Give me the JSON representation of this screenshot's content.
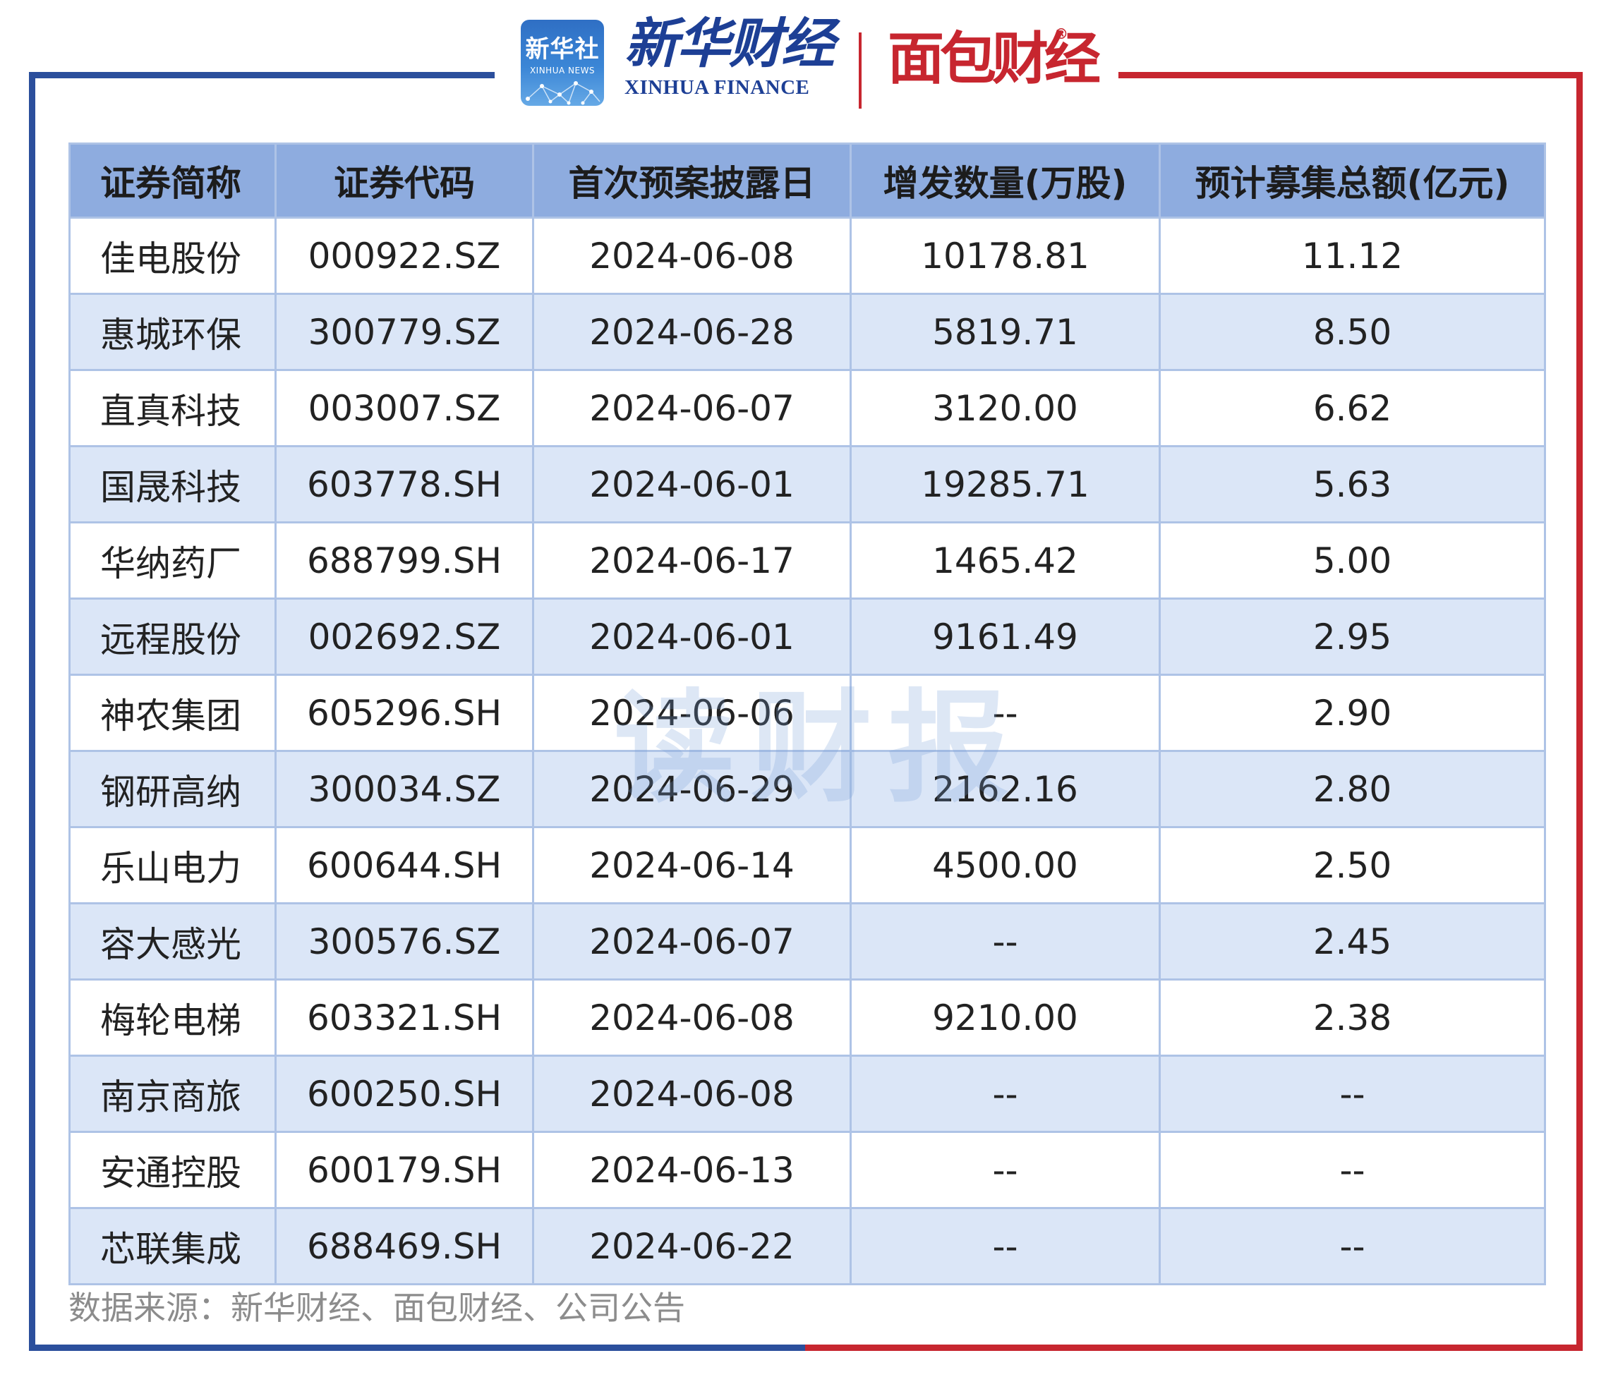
{
  "header": {
    "xinhuashe_logo_cn": "新华社",
    "xinhuashe_logo_en": "XINHUA NEWS",
    "xinhua_finance_cn": "新华财经",
    "xinhua_finance_en": "XINHUA FINANCE",
    "mianbao_logo": "面包财经",
    "registered_mark": "®",
    "brand_colors": {
      "blue": "#2b4f9c",
      "red": "#c7262f"
    }
  },
  "table": {
    "columns": [
      "证券简称",
      "证券代码",
      "首次预案披露日",
      "增发数量(万股)",
      "预计募集总额(亿元)"
    ],
    "rows": [
      [
        "佳电股份",
        "000922.SZ",
        "2024-06-08",
        "10178.81",
        "11.12"
      ],
      [
        "惠城环保",
        "300779.SZ",
        "2024-06-28",
        "5819.71",
        "8.50"
      ],
      [
        "直真科技",
        "003007.SZ",
        "2024-06-07",
        "3120.00",
        "6.62"
      ],
      [
        "国晟科技",
        "603778.SH",
        "2024-06-01",
        "19285.71",
        "5.63"
      ],
      [
        "华纳药厂",
        "688799.SH",
        "2024-06-17",
        "1465.42",
        "5.00"
      ],
      [
        "远程股份",
        "002692.SZ",
        "2024-06-01",
        "9161.49",
        "2.95"
      ],
      [
        "神农集团",
        "605296.SH",
        "2024-06-06",
        "--",
        "2.90"
      ],
      [
        "钢研高纳",
        "300034.SZ",
        "2024-06-29",
        "2162.16",
        "2.80"
      ],
      [
        "乐山电力",
        "600644.SH",
        "2024-06-14",
        "4500.00",
        "2.50"
      ],
      [
        "容大感光",
        "300576.SZ",
        "2024-06-07",
        "--",
        "2.45"
      ],
      [
        "梅轮电梯",
        "603321.SH",
        "2024-06-08",
        "9210.00",
        "2.38"
      ],
      [
        "南京商旅",
        "600250.SH",
        "2024-06-08",
        "--",
        "--"
      ],
      [
        "安通控股",
        "600179.SH",
        "2024-06-13",
        "--",
        "--"
      ],
      [
        "芯联集成",
        "688469.SH",
        "2024-06-22",
        "--",
        "--"
      ]
    ]
  },
  "watermark": "读财报",
  "source": "数据来源：新华财经、面包财经、公司公告"
}
